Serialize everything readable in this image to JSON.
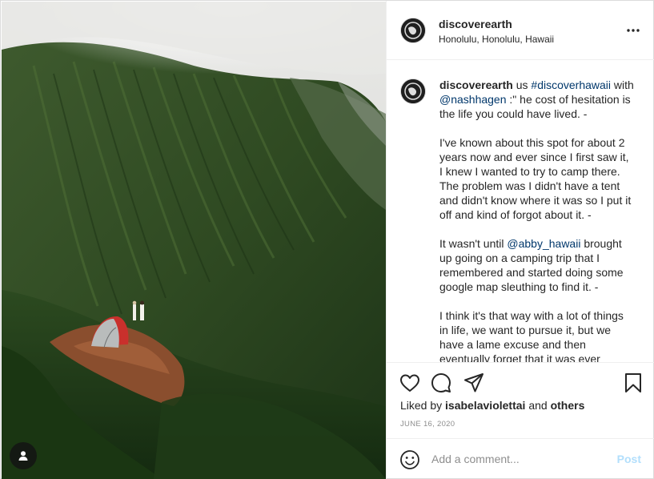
{
  "post": {
    "username": "discoverearth",
    "location": "Honolulu, Honolulu, Hawaii",
    "caption": {
      "username": "discoverearth",
      "line1_pre": " us ",
      "hashtag": "#discoverhawaii",
      "line1_post": " with",
      "mention1": "@nashhagen",
      "para1_rest": " :\" he cost of hesitation is the life you could have lived. -",
      "para2": "I've known about this spot for about 2 years now and ever since I first saw it, I knew I wanted to try to camp there. The problem was I didn't have a tent and didn't know where it was so I put it off and kind of forgot about it. -",
      "para3_pre": "It wasn't until ",
      "mention2": "@abby_hawaii",
      "para3_post": " brought up going on a camping trip that I remembered and started doing some google map sleuthing to find it. -",
      "para4": "I think it's that way with a lot of things in life, we want to pursue it, but we have a lame excuse and then eventually forget that it was ever before."
    },
    "likes": {
      "prefix": "Liked by ",
      "user": "isabelaviolettai",
      "middle": " and ",
      "others": "others"
    },
    "date": "JUNE 16, 2020",
    "comment": {
      "placeholder": "Add a comment...",
      "post_label": "Post"
    }
  },
  "icons": [
    "tag-user-icon",
    "more-options-icon",
    "heart-icon",
    "comment-icon",
    "share-icon",
    "bookmark-icon",
    "emoji-icon"
  ],
  "colors": {
    "link": "#00376b",
    "post_button_disabled": "#b2dffc",
    "muted": "#8e8e8e"
  }
}
